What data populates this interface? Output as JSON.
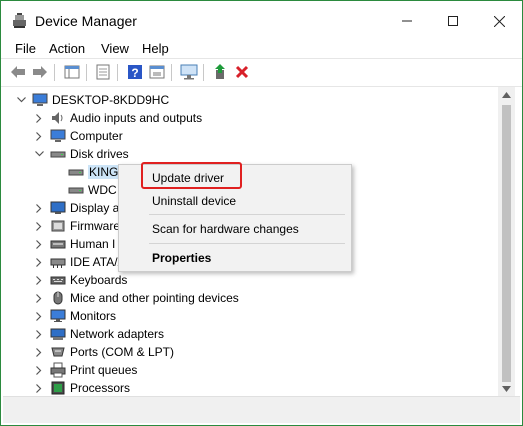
{
  "window": {
    "title": "Device Manager"
  },
  "menubar": {
    "items": [
      "File",
      "Action",
      "View",
      "Help"
    ]
  },
  "toolbar": {
    "icons": [
      "back-arrow-icon",
      "forward-arrow-icon",
      "properties-grid-icon",
      "document-icon",
      "help-icon",
      "view-icon",
      "monitor-icon",
      "update-driver-icon",
      "uninstall-x-icon"
    ]
  },
  "tree": {
    "root": "DESKTOP-8KDD9HC",
    "items": [
      {
        "label": "Audio inputs and outputs"
      },
      {
        "label": "Computer"
      },
      {
        "label": "Disk drives"
      },
      {
        "label": "KING"
      },
      {
        "label": "WDC"
      },
      {
        "label": "Display a"
      },
      {
        "label": "Firmware"
      },
      {
        "label": "Human I"
      },
      {
        "label": "IDE ATA/A"
      },
      {
        "label": "Keyboards"
      },
      {
        "label": "Mice and other pointing devices"
      },
      {
        "label": "Monitors"
      },
      {
        "label": "Network adapters"
      },
      {
        "label": "Ports (COM & LPT)"
      },
      {
        "label": "Print queues"
      },
      {
        "label": "Processors"
      }
    ]
  },
  "context_menu": {
    "update": "Update driver",
    "uninstall": "Uninstall device",
    "scan": "Scan for hardware changes",
    "properties": "Properties"
  },
  "colors": {
    "highlight": "#e02020",
    "window_border": "#2b8a3e"
  }
}
